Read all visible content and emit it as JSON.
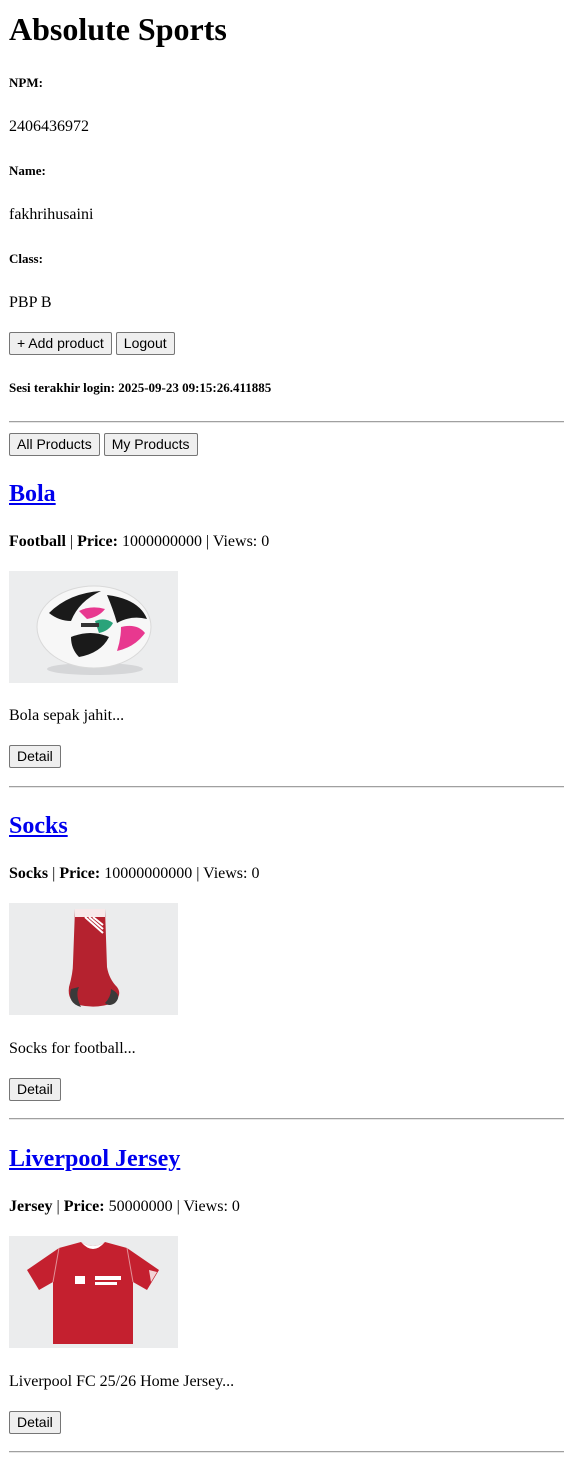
{
  "header": {
    "title": "Absolute Sports",
    "npm_label": "NPM:",
    "npm_value": "2406436972",
    "name_label": "Name:",
    "name_value": "fakhrihusaini",
    "class_label": "Class:",
    "class_value": "PBP B"
  },
  "actions": {
    "add_product_label": "+ Add product",
    "logout_label": "Logout"
  },
  "session": {
    "label": "Sesi terakhir login:",
    "value": "2025-09-23 09:15:26.411885"
  },
  "filters": {
    "all_products_label": "All Products",
    "my_products_label": "My Products"
  },
  "labels": {
    "price": "Price:",
    "views": "Views:",
    "separator": "|",
    "detail_button": "Detail"
  },
  "products": [
    {
      "name": "Bola",
      "category": "Football",
      "price": "1000000000",
      "views": "0",
      "description": "Bola sepak jahit...",
      "image_icon": "football-image"
    },
    {
      "name": "Socks",
      "category": "Socks",
      "price": "10000000000",
      "views": "0",
      "description": "Socks for football...",
      "image_icon": "sock-image"
    },
    {
      "name": "Liverpool Jersey",
      "category": "Jersey",
      "price": "50000000",
      "views": "0",
      "description": "Liverpool FC 25/26 Home Jersey...",
      "image_icon": "jersey-image"
    }
  ],
  "colors": {
    "link": "#0000ee",
    "button_bg": "#efefef",
    "button_border": "#767676",
    "image_bg": "#ebeced",
    "sock_red": "#b5222f",
    "jersey_red": "#c4202f"
  }
}
